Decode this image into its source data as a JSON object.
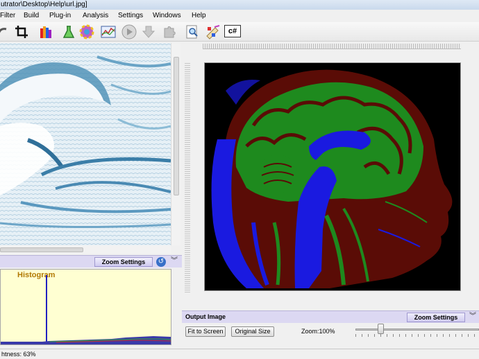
{
  "window": {
    "title": "utrator\\Desktop\\Help\\url.jpg]"
  },
  "menu": {
    "items": [
      "Filter",
      "Build",
      "Plug-in",
      "Analysis",
      "Settings",
      "Windows",
      "Help"
    ]
  },
  "toolbar": {
    "icons": [
      "undo-icon",
      "crop-icon",
      "color-bars-icon",
      "flask-icon",
      "color-wheel-icon",
      "graph-icon",
      "play-icon",
      "down-arrow-icon",
      "puzzle-icon",
      "zoom-doc-icon",
      "paint-palette-icon",
      "csharp-icon"
    ],
    "csharp_label": "c#"
  },
  "left_panel": {
    "zoom_settings_label": "Zoom Settings",
    "histogram_title": "Histogram"
  },
  "output_panel": {
    "label": "Output Image",
    "zoom_settings_label": "Zoom Settings",
    "fit_to_screen_label": "Fit to Screen",
    "original_size_label": "Original Size",
    "zoom_text": "Zoom:100%",
    "zoom_value": 100
  },
  "status": {
    "text": "htness: 63%"
  },
  "colors": {
    "accent_bar": "#dcd8f2",
    "histogram_bg": "#ffffd2",
    "histogram_title": "#b17800",
    "mri_blue": "#1414e6",
    "mri_green": "#1e9c1e",
    "mri_red": "#6a0e08"
  }
}
